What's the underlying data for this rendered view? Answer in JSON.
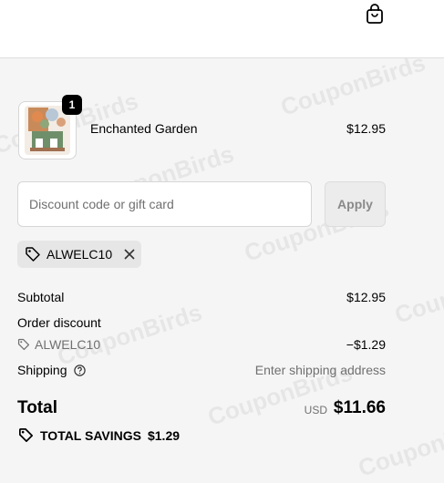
{
  "watermark": "CouponBirds",
  "cart": {
    "quantity": "1",
    "product_name": "Enchanted Garden",
    "product_price": "$12.95"
  },
  "discount": {
    "placeholder": "Discount code or gift card",
    "apply_label": "Apply",
    "applied_code": "ALWELC10"
  },
  "summary": {
    "subtotal_label": "Subtotal",
    "subtotal_value": "$12.95",
    "order_discount_label": "Order discount",
    "discount_code": "ALWELC10",
    "discount_value": "−$1.29",
    "shipping_label": "Shipping",
    "shipping_value": "Enter shipping address",
    "total_label": "Total",
    "currency": "USD",
    "total_value": "$11.66",
    "savings_label": "TOTAL SAVINGS",
    "savings_value": "$1.29"
  }
}
